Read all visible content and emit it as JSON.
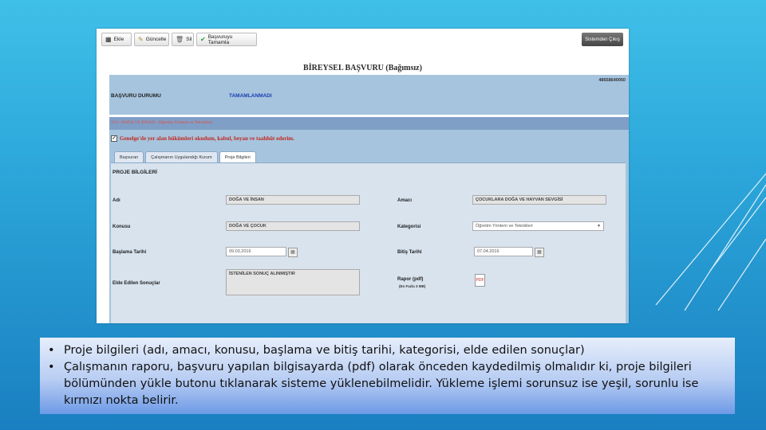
{
  "toolbar": {
    "buttons": [
      {
        "label": "Ekle",
        "icon": "add-icon"
      },
      {
        "label": "Güncelle",
        "icon": "pencil-icon"
      },
      {
        "label": "Sil",
        "icon": "trash-icon"
      },
      {
        "label": "Başvuruyu Tamamla",
        "icon": "checkmark-icon"
      }
    ],
    "logout": "Sistemden Çıkış"
  },
  "header": {
    "title": "BİREYSEL BAŞVURU (Bağımsız)",
    "ref_no": "48658640050"
  },
  "status": {
    "label": "BAŞVURU DURUMU",
    "value": "TAMAMLANMADI"
  },
  "topic": "114 - DOĞA VE İNSAN - Öğretim Yöntem ve Teknikleri",
  "agreement": "Genelge'de yer alan hükümleri okudum, kabul, beyan ve taahhüt ederim.",
  "tabs": [
    "Başvuran",
    "Çalışmanın Uygulandığı Kurum",
    "Proje Bilgileri"
  ],
  "form": {
    "section": "PROJE BİLGİLERİ",
    "adi_label": "Adı",
    "adi_value": "DOĞA VE İNSAN",
    "amaci_label": "Amacı",
    "amaci_value": "ÇOCUKLARA DOĞA VE HAYVAN SEVGİSİ",
    "konusu_label": "Konusu",
    "konusu_value": "DOĞA VE ÇOCUK",
    "kategori_label": "Kategorisi",
    "kategori_value": "Öğretim Yöntem ve Teknikleri",
    "baslama_label": "Başlama Tarihi",
    "baslama_value": "09.03.2016",
    "bitis_label": "Bitiş Tarihi",
    "bitis_value": "07.04.2016",
    "sonuc_label": "Elde Edilen Sonuçlar",
    "sonuc_value": "İSTENİLEN SONUÇ ALINMIŞTIR",
    "rapor_label": "Rapor (pdf)",
    "rapor_sub": "(En Fazla 3 MB)"
  },
  "notes": {
    "bullet": "•",
    "items": [
      "Proje bilgileri (adı, amacı, konusu, başlama ve bitiş tarihi, kategorisi, elde edilen sonuçlar)",
      "Çalışmanın raporu, başvuru yapılan bilgisayarda (pdf) olarak önceden kaydedilmiş olmalıdır ki, proje bilgileri bölümünden yükle butonu tıklanarak sisteme yüklenebilmelidir. Yükleme işlemi sorunsuz ise yeşil, sorunlu ise kırmızı nokta belirir."
    ]
  }
}
